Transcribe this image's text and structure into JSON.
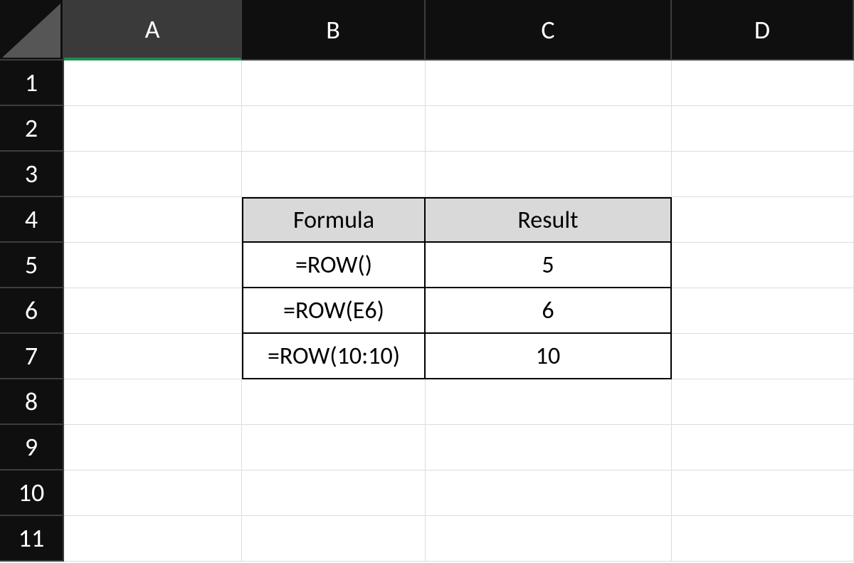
{
  "columns": {
    "A": "A",
    "B": "B",
    "C": "C",
    "D": "D"
  },
  "selected_column": "A",
  "rows": [
    "1",
    "2",
    "3",
    "4",
    "5",
    "6",
    "7",
    "8",
    "9",
    "10",
    "11"
  ],
  "table": {
    "header": {
      "formula": "Formula",
      "result": "Result"
    },
    "rows": [
      {
        "formula": "=ROW()",
        "result": "5"
      },
      {
        "formula": "=ROW(E6)",
        "result": "6"
      },
      {
        "formula": "=ROW(10:10)",
        "result": "10"
      }
    ]
  },
  "chart_data": {
    "type": "table",
    "title": "",
    "columns": [
      "Formula",
      "Result"
    ],
    "rows": [
      [
        "=ROW()",
        5
      ],
      [
        "=ROW(E6)",
        6
      ],
      [
        "=ROW(10:10)",
        10
      ]
    ]
  }
}
